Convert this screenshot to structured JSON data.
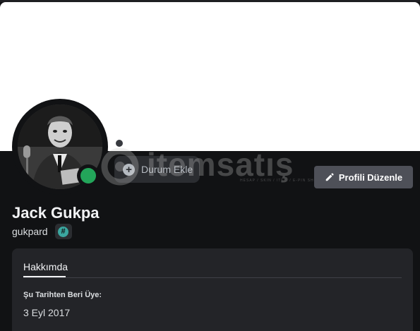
{
  "profile": {
    "display_name": "Jack Gukpa",
    "username": "gukpard",
    "status_color": "#23a55a",
    "badge_icon": "hypesquad-icon",
    "badge_color": "#3ba7a0"
  },
  "status_bubble": {
    "label": "Durum Ekle",
    "icon": "plus-circle-icon"
  },
  "actions": {
    "edit_profile_label": "Profili Düzenle",
    "edit_icon": "pencil-icon"
  },
  "about": {
    "tab_label": "Hakkımda",
    "member_since_label": "Şu Tarihten Beri Üye:",
    "member_since_value": "3 Eyl 2017"
  },
  "watermark": {
    "text": "itemsatış",
    "tagline": "HESAP / SKIN / ITEM / E-PIN SHOP"
  },
  "colors": {
    "background": "#111214",
    "banner": "#ffffff",
    "card": "#232428",
    "button": "#4e5058"
  }
}
